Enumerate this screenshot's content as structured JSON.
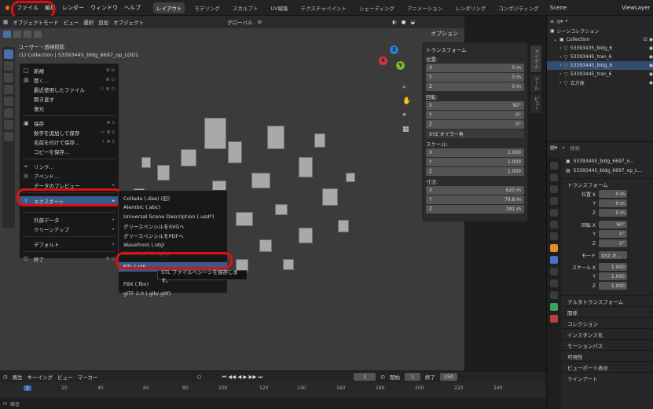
{
  "topbar": {
    "menus": [
      "ファイル",
      "編集",
      "レンダー",
      "ウィンドウ",
      "ヘルプ"
    ],
    "workspaces": [
      "レイアウト",
      "モデリング",
      "スカルプト",
      "UV編集",
      "テクスチャペイント",
      "シェーディング",
      "アニメーション",
      "レンダリング",
      "コンポジティング"
    ],
    "scene": "Scene",
    "viewlayer": "ViewLayer"
  },
  "viewport": {
    "mode": "オブジェクトモード",
    "menus": [
      "ビュー",
      "選択",
      "追加",
      "オブジェクト"
    ],
    "transform_orientation": "グローバル",
    "options": "オプション",
    "view_info_line1": "ユーザー・透視投影",
    "view_info_line2": "(1) Collection | 53393445_bldg_6697_op_LOD1"
  },
  "file_menu": {
    "items": [
      {
        "icon": "□",
        "label": "新規",
        "shortcut": "⌘ N"
      },
      {
        "icon": "▤",
        "label": "開く...",
        "shortcut": "⌘ O"
      },
      {
        "icon": "",
        "label": "最近使用したファイル",
        "shortcut": "⇧ ⌘ O"
      },
      {
        "icon": "",
        "label": "開き直す",
        "shortcut": ""
      },
      {
        "icon": "",
        "label": "復元",
        "shortcut": ""
      },
      {
        "icon": "▣",
        "label": "保存",
        "shortcut": "⌘ S"
      },
      {
        "icon": "",
        "label": "数字を追加して保存",
        "shortcut": "⌥ ⌘ S"
      },
      {
        "icon": "",
        "label": "名前を付けて保存...",
        "shortcut": "⇧ ⌘ S"
      },
      {
        "icon": "",
        "label": "コピーを保存...",
        "shortcut": ""
      },
      {
        "icon": "∞",
        "label": "リンク...",
        "shortcut": ""
      },
      {
        "icon": "◎",
        "label": "アペンド...",
        "shortcut": ""
      },
      {
        "icon": "",
        "label": "データのプレビュー",
        "shortcut": ""
      },
      {
        "icon": "⇧",
        "label": "エクスポート",
        "shortcut": ""
      },
      {
        "icon": "",
        "label": "外部データ",
        "shortcut": ""
      },
      {
        "icon": "",
        "label": "クリーンアップ",
        "shortcut": ""
      },
      {
        "icon": "",
        "label": "デフォルト",
        "shortcut": ""
      },
      {
        "icon": "⏻",
        "label": "終了",
        "shortcut": "⌘ Q"
      }
    ]
  },
  "export_menu": {
    "items": [
      "Collada (.dae) (旧)",
      "Alembic (.abc)",
      "Universal Scene Description (.usd*)",
      "グリースペンシルをSVGへ",
      "グリースペンシルをPDFへ",
      "Wavefront (.obj)",
      "Stanford PLY (.ply)",
      "STL (.stl)",
      "FBX (.fbx)",
      "glTF 2.0 (.glb/.gltf)"
    ],
    "tooltip": "STL ファイルへシーンを保存します。"
  },
  "npanel": {
    "title": "トランスフォーム",
    "location_label": "位置:",
    "location": [
      {
        "axis": "X",
        "value": "0 m"
      },
      {
        "axis": "Y",
        "value": "0 m"
      },
      {
        "axis": "Z",
        "value": "0 m"
      }
    ],
    "rotation_label": "回転:",
    "rotation": [
      {
        "axis": "X",
        "value": "90°"
      },
      {
        "axis": "Y",
        "value": "0°"
      },
      {
        "axis": "Z",
        "value": "0°"
      }
    ],
    "rotation_mode": "XYZ オイラー角",
    "scale_label": "スケール:",
    "scale": [
      {
        "axis": "X",
        "value": "1.000"
      },
      {
        "axis": "Y",
        "value": "1.000"
      },
      {
        "axis": "Z",
        "value": "1.000"
      }
    ],
    "dimensions_label": "寸法:",
    "dimensions": [
      {
        "axis": "X",
        "value": "620 m"
      },
      {
        "axis": "Y",
        "value": "79.8 m"
      },
      {
        "axis": "Z",
        "value": "281 m"
      }
    ],
    "tabs": [
      "アイテム",
      "ツール",
      "ビュー"
    ]
  },
  "timeline": {
    "menus": [
      "再生",
      "キーイング",
      "ビュー",
      "マーカー"
    ],
    "current_frame": "1",
    "start_label": "開始",
    "start": "1",
    "end_label": "終了",
    "end": "250",
    "frames": [
      "1",
      "20",
      "40",
      "60",
      "80",
      "100",
      "120",
      "140",
      "160",
      "180",
      "200",
      "220",
      "240"
    ]
  },
  "outliner": {
    "search_placeholder": "",
    "title": "シーンコレクション",
    "collection": "Collection",
    "items": [
      "53393435_bldg_6",
      "53393445_tran_6",
      "53393445_bldg_6",
      "53393445_tran_6",
      "立方体"
    ]
  },
  "properties": {
    "search_placeholder": "検索",
    "object_name": "53393445_bldg_6697_o...",
    "mesh_name": "53393445_bldg_6697_op_L...",
    "transform_title": "トランスフォーム",
    "location_label": "位置 X",
    "location": [
      "0 m",
      "0 m",
      "0 m"
    ],
    "rotation_label": "回転 X",
    "rotation": [
      "90°",
      "0°",
      "0°"
    ],
    "mode_label": "モード",
    "mode": "XYZ オ...",
    "scale_label": "スケール X",
    "scale": [
      "1.000",
      "1.000",
      "1.000"
    ],
    "sections": [
      "デルタトランスフォーム",
      "関係",
      "コレクション",
      "インスタンス化",
      "モーションパス",
      "可視性",
      "ビューポート表示",
      "ラインアート"
    ]
  },
  "status": {
    "left": "練習"
  }
}
